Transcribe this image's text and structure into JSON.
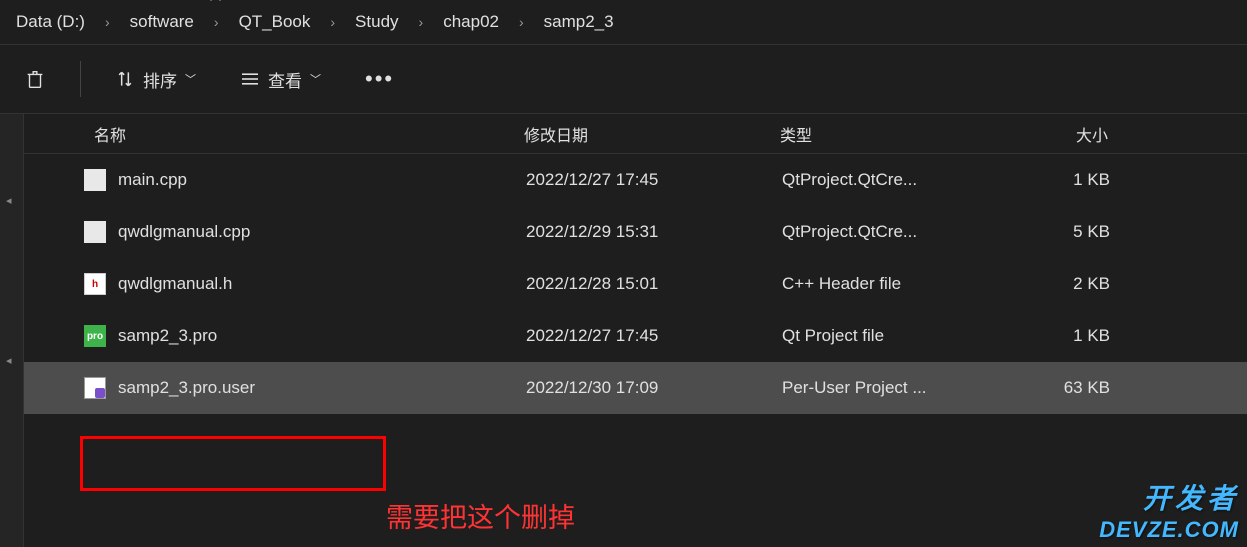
{
  "breadcrumb": [
    {
      "label": "Data (D:)"
    },
    {
      "label": "software"
    },
    {
      "label": "QT_Book"
    },
    {
      "label": "Study"
    },
    {
      "label": "chap02"
    },
    {
      "label": "samp2_3"
    }
  ],
  "toolbar": {
    "sort_label": "排序",
    "view_label": "查看"
  },
  "columns": {
    "name": "名称",
    "date": "修改日期",
    "type": "类型",
    "size": "大小"
  },
  "files": [
    {
      "name": "main.cpp",
      "date": "2022/12/27 17:45",
      "type": "QtProject.QtCre...",
      "size": "1 KB",
      "icon": "generic"
    },
    {
      "name": "qwdlgmanual.cpp",
      "date": "2022/12/29 15:31",
      "type": "QtProject.QtCre...",
      "size": "5 KB",
      "icon": "generic"
    },
    {
      "name": "qwdlgmanual.h",
      "date": "2022/12/28 15:01",
      "type": "C++ Header file",
      "size": "2 KB",
      "icon": "h"
    },
    {
      "name": "samp2_3.pro",
      "date": "2022/12/27 17:45",
      "type": "Qt Project file",
      "size": "1 KB",
      "icon": "pro"
    },
    {
      "name": "samp2_3.pro.user",
      "date": "2022/12/30 17:09",
      "type": "Per-User Project ...",
      "size": "63 KB",
      "icon": "user",
      "selected": true
    }
  ],
  "annotation": "需要把这个删掉",
  "watermark": {
    "line1": "开发者",
    "line2": "DEVZE.COM"
  }
}
